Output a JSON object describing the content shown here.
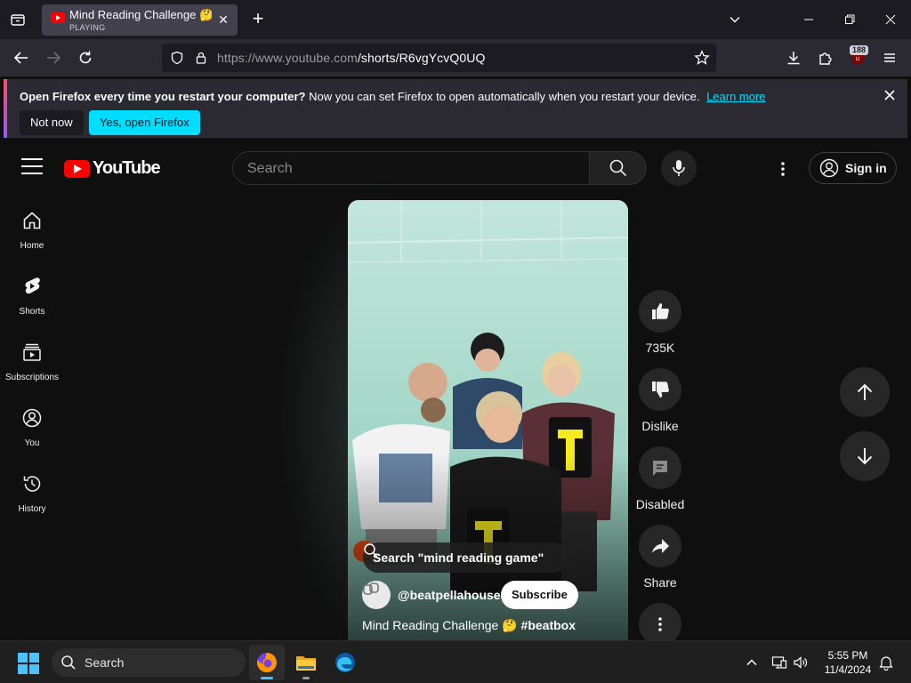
{
  "browser": {
    "tab": {
      "title": "Mind Reading Challenge 🤔 #beatbox",
      "status": "PLAYING"
    },
    "url": {
      "host": "https://www.youtube.com",
      "path": "/shorts/R6vgYcvQ0UQ"
    },
    "extension_badge": "188",
    "notification": {
      "headline": "Open Firefox every time you restart your computer?",
      "body": "Now you can set Firefox to open automatically when you restart your device.",
      "link": "Learn more",
      "dismiss_button": "Not now",
      "confirm_button": "Yes, open Firefox"
    }
  },
  "youtube": {
    "logo_text": "YouTube",
    "search_placeholder": "Search",
    "sign_in": "Sign in",
    "brand_color": "#ff0000",
    "guide": [
      {
        "label": "Home",
        "icon": "home-icon"
      },
      {
        "label": "Shorts",
        "icon": "shorts-icon"
      },
      {
        "label": "Subscriptions",
        "icon": "subscriptions-icon"
      },
      {
        "label": "You",
        "icon": "you-icon"
      },
      {
        "label": "History",
        "icon": "history-icon"
      }
    ],
    "short": {
      "search_pill": "Search \"mind reading game\"",
      "channel": "@beatpellahouse",
      "subscribe": "Subscribe",
      "title": "Mind Reading Challenge 🤔",
      "hashtag": "#beatbox",
      "card_letter": "T"
    },
    "actions": {
      "likes": "735K",
      "dislike": "Dislike",
      "comments": "Disabled",
      "share": "Share"
    }
  },
  "taskbar": {
    "search": "Search",
    "time": "5:55 PM",
    "date": "11/4/2024"
  }
}
